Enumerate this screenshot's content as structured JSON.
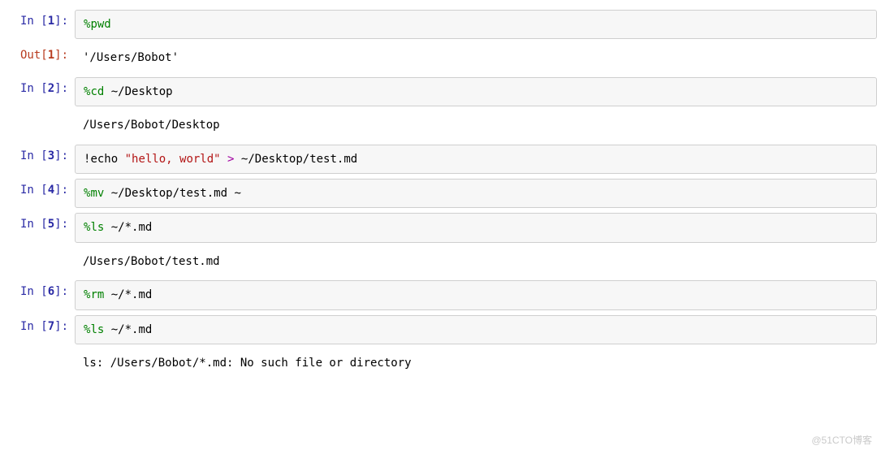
{
  "prompt_style": {
    "in_label": "In ",
    "out_label": "Out"
  },
  "cells": [
    {
      "kind": "in",
      "n": 1,
      "tokens": [
        {
          "cls": "tk-magic",
          "text": "%"
        },
        {
          "cls": "tk-cmd",
          "text": "pwd"
        }
      ]
    },
    {
      "kind": "out",
      "n": 1,
      "tokens": [
        {
          "cls": "tk-outstr",
          "text": "'/Users/Bobot'"
        }
      ]
    },
    {
      "kind": "in",
      "n": 2,
      "tokens": [
        {
          "cls": "tk-magic",
          "text": "%"
        },
        {
          "cls": "tk-cmd",
          "text": "cd"
        },
        {
          "cls": "tk-path",
          "text": " ~/Desktop"
        }
      ]
    },
    {
      "kind": "stdout",
      "n": 2,
      "tokens": [
        {
          "cls": "tk-plain",
          "text": "/Users/Bobot/Desktop"
        }
      ]
    },
    {
      "kind": "in",
      "n": 3,
      "tokens": [
        {
          "cls": "tk-bang",
          "text": "!"
        },
        {
          "cls": "tk-shell",
          "text": "echo "
        },
        {
          "cls": "tk-string",
          "text": "\"hello, world\""
        },
        {
          "cls": "tk-shell",
          "text": " "
        },
        {
          "cls": "tk-op",
          "text": ">"
        },
        {
          "cls": "tk-shell",
          "text": " ~/Desktop/test.md"
        }
      ]
    },
    {
      "kind": "in",
      "n": 4,
      "tokens": [
        {
          "cls": "tk-magic",
          "text": "%"
        },
        {
          "cls": "tk-cmd",
          "text": "mv"
        },
        {
          "cls": "tk-path",
          "text": " ~/Desktop/test.md ~"
        }
      ]
    },
    {
      "kind": "in",
      "n": 5,
      "tokens": [
        {
          "cls": "tk-magic",
          "text": "%"
        },
        {
          "cls": "tk-cmd",
          "text": "ls"
        },
        {
          "cls": "tk-path",
          "text": " ~/*.md"
        }
      ]
    },
    {
      "kind": "stdout",
      "n": 5,
      "tokens": [
        {
          "cls": "tk-plain",
          "text": "/Users/Bobot/test.md"
        }
      ]
    },
    {
      "kind": "in",
      "n": 6,
      "tokens": [
        {
          "cls": "tk-magic",
          "text": "%"
        },
        {
          "cls": "tk-cmd",
          "text": "rm"
        },
        {
          "cls": "tk-path",
          "text": " ~/*.md"
        }
      ]
    },
    {
      "kind": "in",
      "n": 7,
      "tokens": [
        {
          "cls": "tk-magic",
          "text": "%"
        },
        {
          "cls": "tk-cmd",
          "text": "ls"
        },
        {
          "cls": "tk-path",
          "text": " ~/*.md"
        }
      ]
    },
    {
      "kind": "stdout",
      "n": 7,
      "tokens": [
        {
          "cls": "tk-plain",
          "text": "ls: /Users/Bobot/*.md: No such file or directory"
        }
      ]
    }
  ],
  "watermark": "@51CTO博客"
}
